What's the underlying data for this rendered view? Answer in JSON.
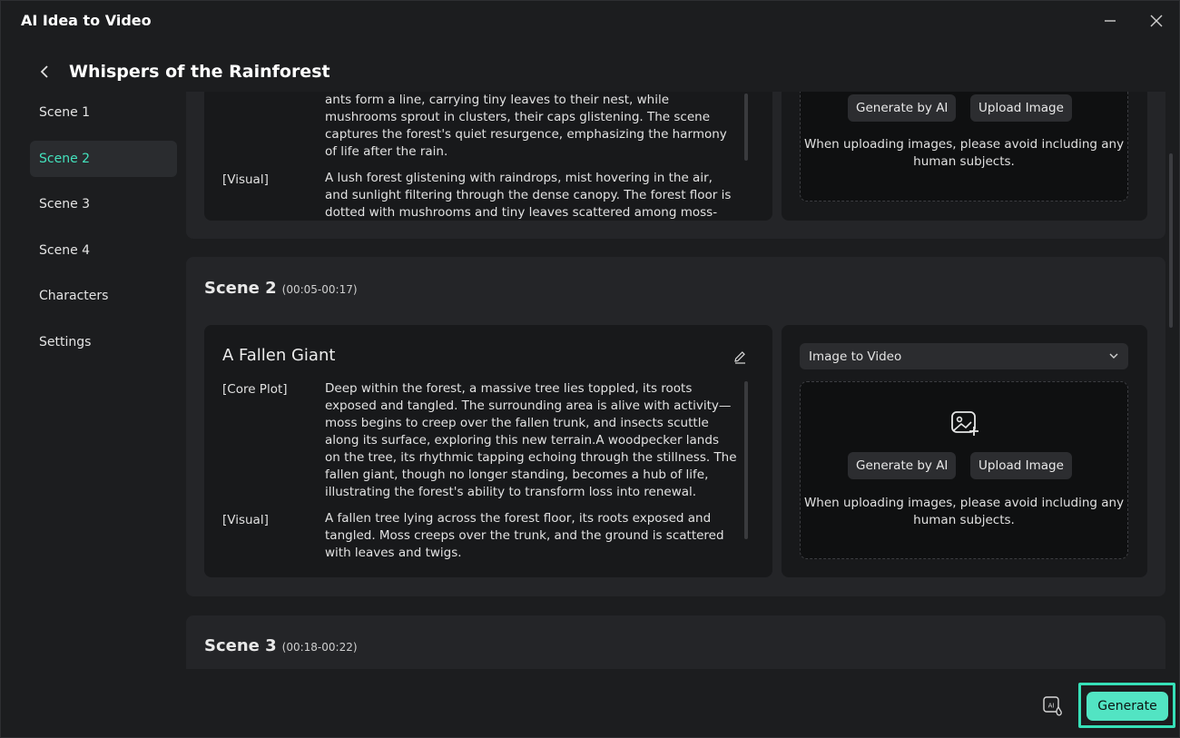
{
  "window": {
    "title": "AI Idea to Video"
  },
  "header": {
    "project_title": "Whispers of the Rainforest"
  },
  "sidebar": {
    "items": [
      {
        "label": "Scene 1"
      },
      {
        "label": "Scene 2"
      },
      {
        "label": "Scene 3"
      },
      {
        "label": "Scene 4"
      },
      {
        "label": "Characters"
      },
      {
        "label": "Settings"
      }
    ],
    "active": "Scene 2"
  },
  "scene1": {
    "core_text_partial": "ants form a line, carrying tiny leaves to their nest, while mushrooms sprout in clusters, their caps glistening. The scene captures the forest's quiet resurgence, emphasizing the harmony of life after the rain.",
    "visual_label": "[Visual]",
    "visual_text": "A lush forest glistening with raindrops, mist hovering in the air, and sunlight filtering through the dense canopy. The forest floor is dotted with mushrooms and tiny leaves scattered among moss-",
    "generate_ai_label": "Generate by AI",
    "upload_label": "Upload Image",
    "upload_note": "When uploading images, please avoid including any human subjects."
  },
  "scene2": {
    "heading": "Scene 2",
    "time": "(00:05-00:17)",
    "title": "A Fallen Giant",
    "core_label": "[Core Plot]",
    "core_text": "Deep within the forest, a massive tree lies toppled, its roots exposed and tangled. The surrounding area is alive with activity—moss begins to creep over the fallen trunk, and insects scuttle along its surface, exploring this new terrain.A woodpecker lands on the tree, its rhythmic tapping echoing through the stillness. The fallen giant, though no longer standing, becomes a hub of life, illustrating the forest's ability to transform loss into renewal.",
    "visual_label": "[Visual]",
    "visual_text": "A fallen tree lying across the forest floor, its roots exposed and tangled. Moss creeps over the trunk, and the ground is scattered with leaves and twigs.",
    "mode": "Image to Video",
    "generate_ai_label": "Generate by AI",
    "upload_label": "Upload Image",
    "upload_note": "When uploading images, please avoid including any human subjects."
  },
  "scene3": {
    "heading": "Scene 3",
    "time": "(00:18-00:22)"
  },
  "footer": {
    "generate_label": "Generate"
  },
  "colors": {
    "accent": "#43e2bd",
    "button_primary": "#52e4c3",
    "highlight": "#36e0b8"
  }
}
